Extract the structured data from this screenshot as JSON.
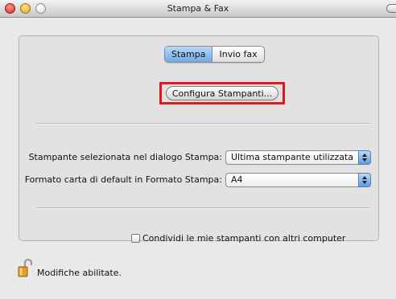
{
  "window": {
    "title": "Stampa & Fax"
  },
  "tabs": [
    {
      "label": "Stampa",
      "selected": true
    },
    {
      "label": "Invio fax",
      "selected": false
    }
  ],
  "main": {
    "configure_button_label": "Configura Stampanti...",
    "selected_printer_label": "Stampante selezionata nel dialogo Stampa:",
    "selected_printer_value": "Ultima stampante utilizzata",
    "paper_format_label": "Formato carta di default in Formato Stampa:",
    "paper_format_value": "A4",
    "share_checkbox_label": "Condividi le mie stampanti con altri computer",
    "share_checked": false
  },
  "footer": {
    "lock_status": "Modifiche abilitate.",
    "lock_icon": "unlocked-padlock-icon"
  },
  "colors": {
    "highlight": "#e0191c",
    "tab_selected": "#6fa8e6",
    "popup_arrow": "#5d9be0"
  }
}
